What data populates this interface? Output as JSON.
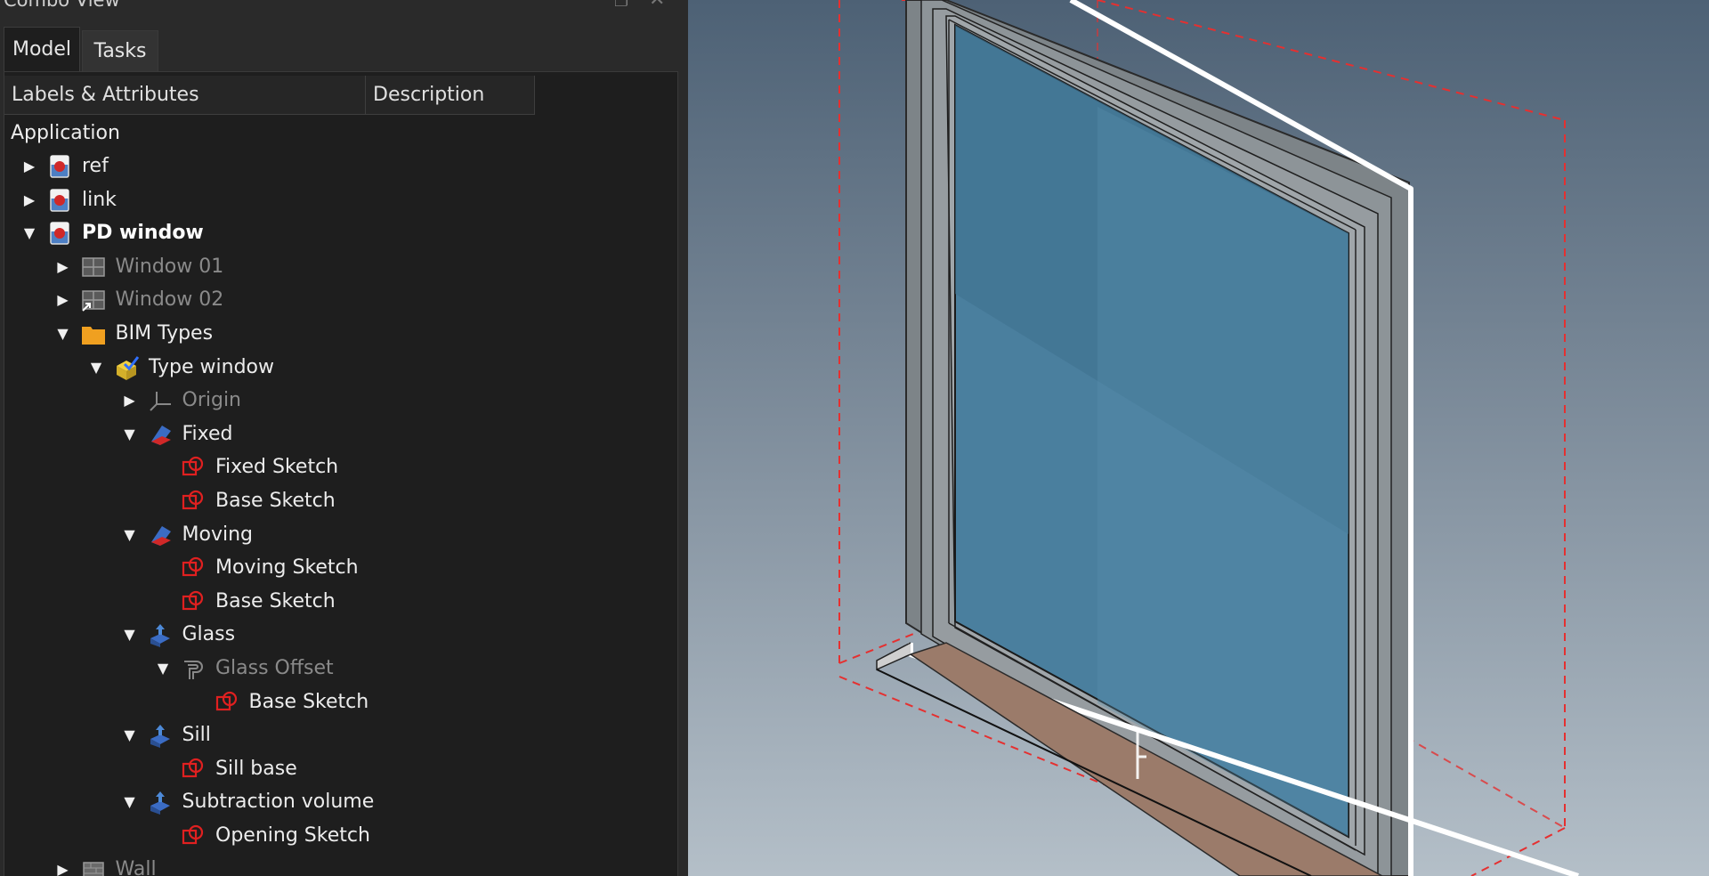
{
  "combo_view": {
    "title": "Combo View",
    "tabs": [
      {
        "label": "Model",
        "active": true
      },
      {
        "label": "Tasks",
        "active": false
      }
    ],
    "columns": [
      "Labels & Attributes",
      "Description"
    ],
    "root_label": "Application",
    "tree": [
      {
        "label": "ref",
        "icon": "document-icon",
        "expander": "collapsed",
        "state": "normal"
      },
      {
        "label": "link",
        "icon": "document-icon",
        "expander": "collapsed",
        "state": "normal"
      },
      {
        "label": "PD window",
        "icon": "document-icon",
        "expander": "expanded",
        "state": "bold"
      },
      {
        "label": "Window 01",
        "icon": "window-icon",
        "expander": "collapsed",
        "state": "dim"
      },
      {
        "label": "Window 02",
        "icon": "window-link-icon",
        "expander": "collapsed",
        "state": "dim"
      },
      {
        "label": "BIM Types",
        "icon": "folder-icon",
        "expander": "expanded",
        "state": "normal"
      },
      {
        "label": "Type window",
        "icon": "part-body-icon",
        "expander": "expanded",
        "state": "normal"
      },
      {
        "label": "Origin",
        "icon": "origin-icon",
        "expander": "collapsed",
        "state": "dim"
      },
      {
        "label": "Fixed",
        "icon": "feature-icon",
        "expander": "expanded",
        "state": "normal"
      },
      {
        "label": "Fixed Sketch",
        "icon": "sketch-icon",
        "expander": "none",
        "state": "normal"
      },
      {
        "label": "Base Sketch",
        "icon": "sketch-icon",
        "expander": "none",
        "state": "normal"
      },
      {
        "label": "Moving",
        "icon": "feature-icon",
        "expander": "expanded",
        "state": "normal"
      },
      {
        "label": "Moving Sketch",
        "icon": "sketch-icon",
        "expander": "none",
        "state": "normal"
      },
      {
        "label": "Base Sketch",
        "icon": "sketch-icon",
        "expander": "none",
        "state": "normal"
      },
      {
        "label": "Glass",
        "icon": "extrude-icon",
        "expander": "expanded",
        "state": "normal"
      },
      {
        "label": "Glass Offset",
        "icon": "offset-icon",
        "expander": "expanded",
        "state": "dim"
      },
      {
        "label": "Base Sketch",
        "icon": "sketch-icon",
        "expander": "none",
        "state": "normal"
      },
      {
        "label": "Sill",
        "icon": "extrude-icon",
        "expander": "expanded",
        "state": "normal"
      },
      {
        "label": "Sill base",
        "icon": "sketch-icon",
        "expander": "none",
        "state": "normal"
      },
      {
        "label": "Subtraction volume",
        "icon": "extrude-icon",
        "expander": "expanded",
        "state": "normal"
      },
      {
        "label": "Opening Sketch",
        "icon": "sketch-icon",
        "expander": "none",
        "state": "normal"
      },
      {
        "label": "Wall",
        "icon": "wall-icon",
        "expander": "collapsed",
        "state": "dim"
      }
    ]
  },
  "colors": {
    "panel_bg": "#1e1e1e",
    "sketch_red": "#e02020",
    "glass_blue": "#4a7f9e",
    "sill_brown": "#9b7b6a",
    "bbox_red": "#e53030"
  }
}
